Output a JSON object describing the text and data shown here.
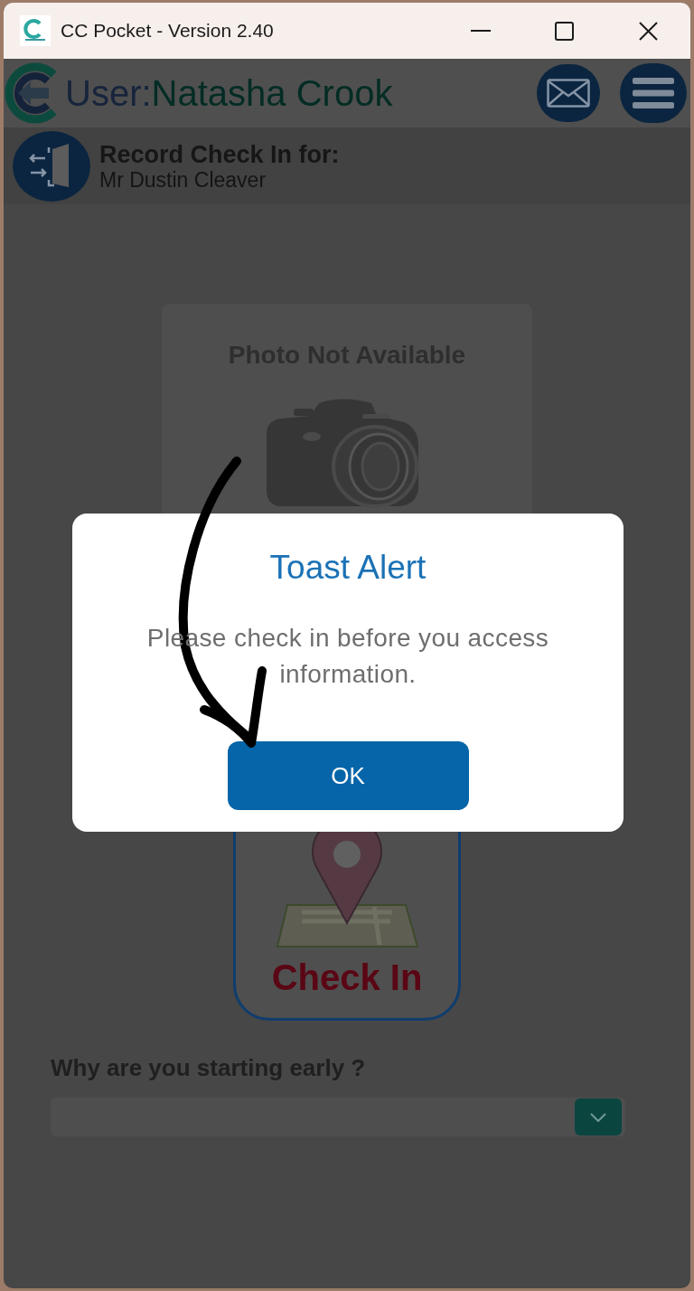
{
  "window": {
    "title": "CC Pocket - Version 2.40"
  },
  "header": {
    "user_label": "User:",
    "user_name": "Natasha Crook"
  },
  "record_bar": {
    "title": "Record Check In for:",
    "subtitle": "Mr Dustin Cleaver"
  },
  "photo": {
    "caption": "Photo Not Available"
  },
  "check_in_button": {
    "label": "Check In"
  },
  "early_reason": {
    "question": "Why are you starting early ?"
  },
  "dialog": {
    "title": "Toast Alert",
    "message": "Please check in before you access information.",
    "button": "OK"
  }
}
